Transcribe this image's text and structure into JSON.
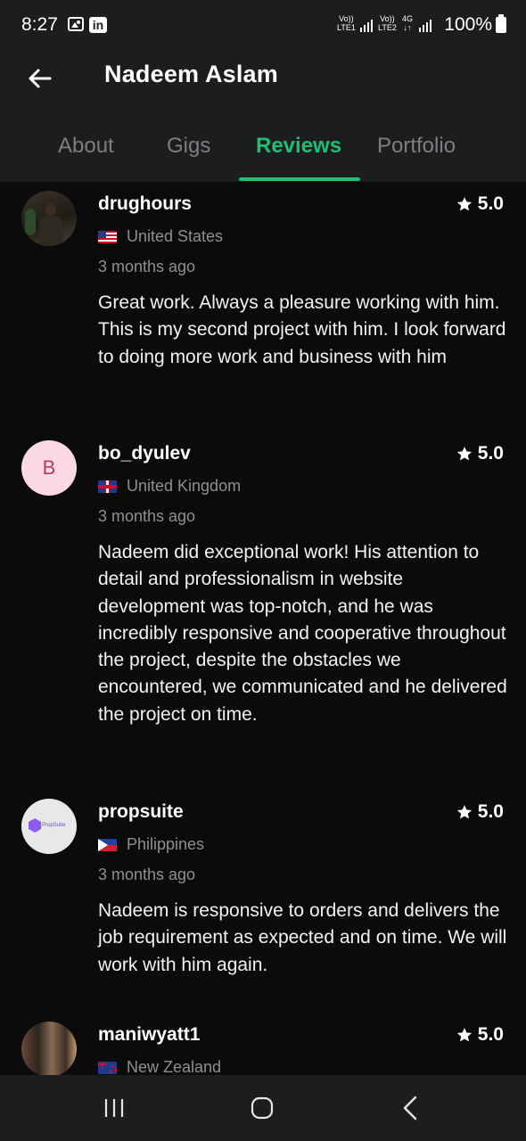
{
  "status_bar": {
    "time": "8:27",
    "notifications": [
      "image-icon",
      "linkedin-icon"
    ],
    "sim1_top": "Vo))",
    "sim1_bottom": "LTE1",
    "sim2_top": "Vo))",
    "sim2_bottom": "LTE2",
    "network": "4G",
    "battery": "100%"
  },
  "header": {
    "title": "Nadeem Aslam",
    "back_icon": "arrow-left-icon"
  },
  "tabs": [
    {
      "label": "About",
      "active": false
    },
    {
      "label": "Gigs",
      "active": false
    },
    {
      "label": "Reviews",
      "active": true
    },
    {
      "label": "Portfolio",
      "active": false
    }
  ],
  "colors": {
    "accent": "#1dbf73",
    "background": "#0b0b0b",
    "header_background": "#1c1d1f",
    "muted_text": "#8d8f93"
  },
  "reviews": [
    {
      "username": "drughours",
      "rating": "5.0",
      "country": "United States",
      "time_ago": "3 months ago",
      "text": "Great work. Always a pleasure working with him. This is my second project with him. I look forward to doing more work and business with him"
    },
    {
      "username": "bo_dyulev",
      "avatar_letter": "B",
      "rating": "5.0",
      "country": "United Kingdom",
      "time_ago": "3 months ago",
      "text": "Nadeem did exceptional work! His attention to detail and professionalism in website development was top-notch, and he was incredibly responsive and cooperative throughout the project, despite the obstacles we encountered, we communicated and he delivered the project on time."
    },
    {
      "username": "propsuite",
      "avatar_text": "PropSuite",
      "rating": "5.0",
      "country": "Philippines",
      "time_ago": "3 months ago",
      "text": "Nadeem is responsive to orders and delivers the job requirement as expected and on time. We will work with him again."
    },
    {
      "username": "maniwyatt1",
      "rating": "5.0",
      "country": "New Zealand"
    }
  ],
  "nav_bar": {
    "buttons": [
      "recent-apps-icon",
      "home-icon",
      "back-icon"
    ]
  }
}
